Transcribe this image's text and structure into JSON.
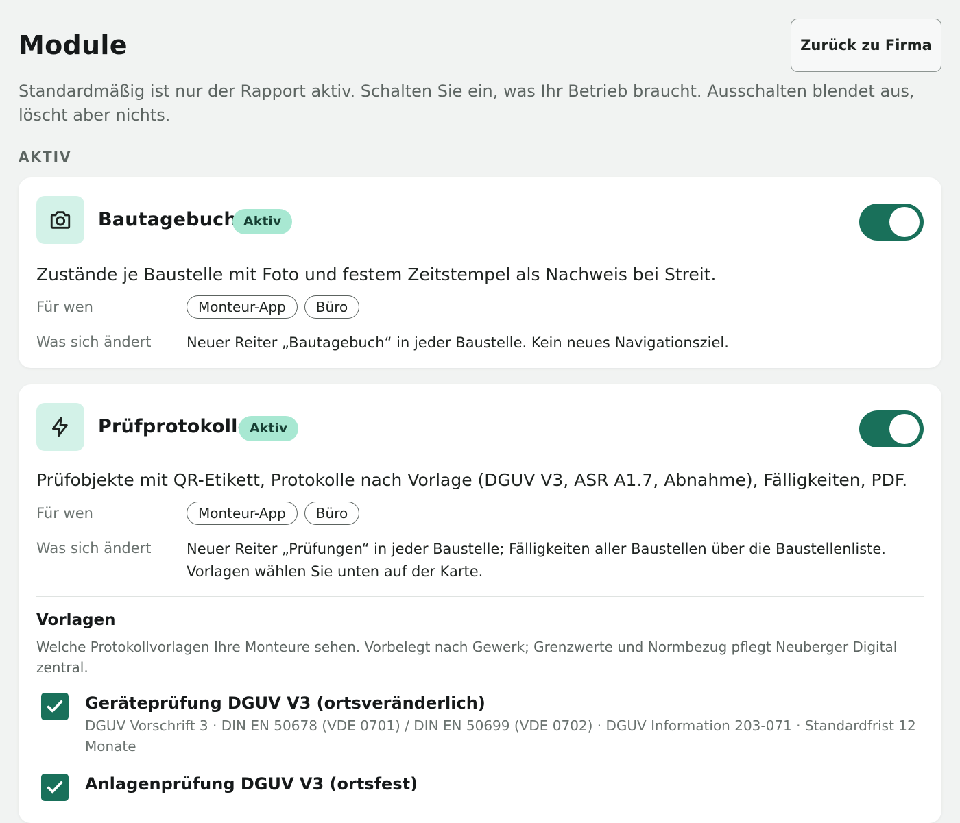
{
  "header": {
    "title": "Module",
    "back_button": "Zurück zu Firma",
    "intro": "Standardmäßig ist nur der Rapport aktiv. Schalten Sie ein, was Ihr Betrieb braucht. Ausschalten blendet aus, löscht aber nichts."
  },
  "section_label": "AKTIV",
  "modules": [
    {
      "name": "Bautagebuch",
      "icon": "camera-icon",
      "badge": "Aktiv",
      "enabled": true,
      "description": "Zustände je Baustelle mit Foto und festem Zeitstempel als Nachweis bei Streit.",
      "for_whom_label": "Für wen",
      "for_whom": [
        "Monteur-App",
        "Büro"
      ],
      "changes_label": "Was sich ändert",
      "changes": "Neuer Reiter „Bautagebuch“ in jeder Baustelle. Kein neues Navigationsziel."
    },
    {
      "name": "Prüfprotokolle",
      "icon": "lightning-icon",
      "badge": "Aktiv",
      "enabled": true,
      "description": "Prüfobjekte mit QR-Etikett, Protokolle nach Vorlage (DGUV V3, ASR A1.7, Abnahme), Fälligkeiten, PDF.",
      "for_whom_label": "Für wen",
      "for_whom": [
        "Monteur-App",
        "Büro"
      ],
      "changes_label": "Was sich ändert",
      "changes": "Neuer Reiter „Prüfungen“ in jeder Baustelle; Fälligkeiten aller Baustellen über die Baustellenliste. Vorlagen wählen Sie unten auf der Karte.",
      "templates": {
        "title": "Vorlagen",
        "description": "Welche Protokollvorlagen Ihre Monteure sehen. Vorbelegt nach Gewerk; Grenzwerte und Normbezug pflegt Neuberger Digital zentral.",
        "items": [
          {
            "name": "Geräteprüfung DGUV V3 (ortsveränderlich)",
            "details": "DGUV Vorschrift 3 · DIN EN 50678 (VDE 0701) / DIN EN 50699 (VDE 0702) · DGUV Information 203-071 · Standardfrist 12 Monate",
            "checked": true
          },
          {
            "name": "Anlagenprüfung DGUV V3 (ortsfest)",
            "details": "",
            "checked": true
          }
        ]
      }
    }
  ],
  "colors": {
    "accent": "#19705a",
    "badge_bg": "#a8e8d2",
    "icon_bg": "#d3f2e8",
    "page_bg": "#f1f3f2"
  }
}
